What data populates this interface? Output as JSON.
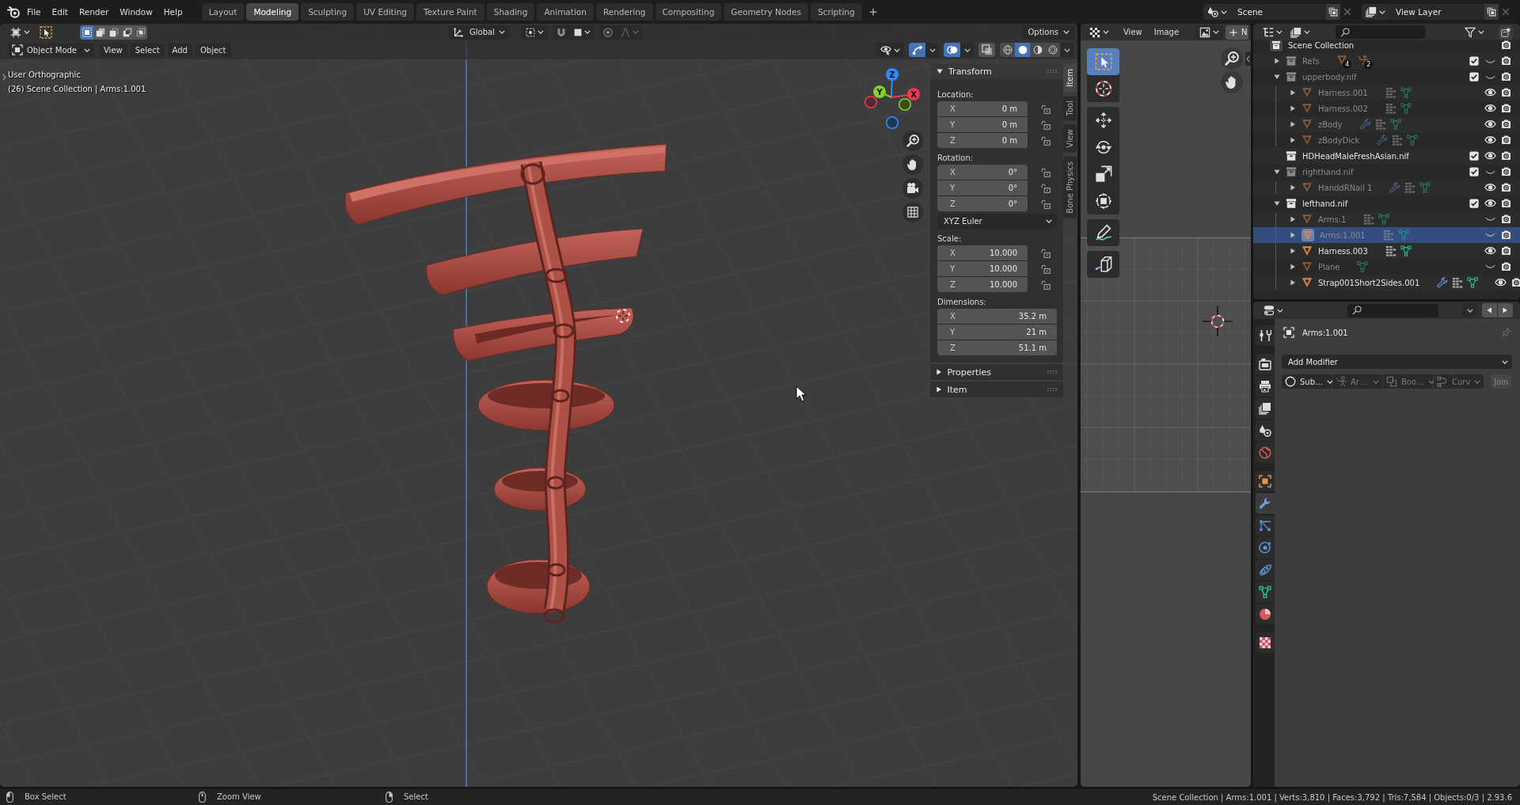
{
  "topbar": {
    "menus": [
      "File",
      "Edit",
      "Render",
      "Window",
      "Help"
    ],
    "workspaces": [
      {
        "label": "Layout",
        "selected": false
      },
      {
        "label": "Modeling",
        "selected": true
      },
      {
        "label": "Sculpting",
        "selected": false
      },
      {
        "label": "UV Editing",
        "selected": false
      },
      {
        "label": "Texture Paint",
        "selected": false
      },
      {
        "label": "Shading",
        "selected": false
      },
      {
        "label": "Animation",
        "selected": false
      },
      {
        "label": "Rendering",
        "selected": false
      },
      {
        "label": "Compositing",
        "selected": false
      },
      {
        "label": "Geometry Nodes",
        "selected": false
      },
      {
        "label": "Scripting",
        "selected": false
      }
    ],
    "scene": "Scene",
    "view_layer": "View Layer"
  },
  "viewport": {
    "tool_header": {
      "select_modes": [
        {
          "kind": "new",
          "selected": true
        },
        {
          "kind": "extend",
          "selected": false
        },
        {
          "kind": "subtract",
          "selected": false
        },
        {
          "kind": "invert",
          "selected": false
        },
        {
          "kind": "intersect",
          "selected": false
        }
      ],
      "orientation": "Global",
      "snap": {
        "on": false
      },
      "proportional_editing": {
        "on": false
      },
      "options": "Options"
    },
    "header": {
      "mode": "Object Mode",
      "menus": [
        "View",
        "Select",
        "Add",
        "Object"
      ],
      "toggles": [
        {
          "kind": "gizmos",
          "on": true
        },
        {
          "kind": "overlays",
          "on": true
        },
        {
          "kind": "xray",
          "on": false
        }
      ],
      "shading": [
        {
          "kind": "wireframe",
          "selected": false
        },
        {
          "kind": "solid",
          "selected": true
        },
        {
          "kind": "material",
          "selected": false
        },
        {
          "kind": "rendered",
          "selected": false
        }
      ]
    },
    "overlay_text": [
      "User Orthographic",
      "(26) Scene Collection | Arms:1.001"
    ],
    "gizmo": [
      {
        "kind": "z",
        "label": "Z"
      },
      {
        "kind": "y",
        "label": "Y"
      },
      {
        "kind": "x",
        "label": "X"
      }
    ],
    "sidebar": {
      "tabs": [
        {
          "label": "Item",
          "selected": true
        },
        {
          "label": "Tool",
          "selected": false
        },
        {
          "label": "View",
          "selected": false
        },
        {
          "label": "Bone Physics",
          "selected": false
        }
      ],
      "panels": [
        {
          "title": "Transform",
          "expanded": true,
          "groups": [
            {
              "label": "Location:",
              "fields": [
                {
                  "axis": "X",
                  "value": "0 m",
                  "locked": false
                },
                {
                  "axis": "Y",
                  "value": "0 m",
                  "locked": false
                },
                {
                  "axis": "Z",
                  "value": "0 m",
                  "locked": false
                }
              ]
            },
            {
              "label": "Rotation:",
              "fields": [
                {
                  "axis": "X",
                  "value": "0°",
                  "locked": false
                },
                {
                  "axis": "Y",
                  "value": "0°",
                  "locked": false
                },
                {
                  "axis": "Z",
                  "value": "0°",
                  "locked": false
                }
              ],
              "mode": "XYZ Euler"
            },
            {
              "label": "Scale:",
              "fields": [
                {
                  "axis": "X",
                  "value": "10.000",
                  "locked": false
                },
                {
                  "axis": "Y",
                  "value": "10.000",
                  "locked": false
                },
                {
                  "axis": "Z",
                  "value": "10.000",
                  "locked": false
                }
              ]
            },
            {
              "label": "Dimensions:",
              "fields": [
                {
                  "axis": "X",
                  "value": "35.2 m"
                },
                {
                  "axis": "Y",
                  "value": "21 m"
                },
                {
                  "axis": "Z",
                  "value": "51.1 m"
                }
              ]
            }
          ]
        },
        {
          "title": "Properties",
          "expanded": false
        },
        {
          "title": "Item",
          "expanded": false
        }
      ]
    }
  },
  "image_editor": {
    "menus": [
      "View",
      "Image"
    ],
    "new_button": "N",
    "tool_groups": [
      {
        "tools": [
          {
            "kind": "select-box",
            "selected": true
          },
          {
            "kind": "cursor",
            "selected": false
          }
        ]
      },
      {
        "tools": [
          {
            "kind": "move",
            "selected": false
          },
          {
            "kind": "rotate",
            "selected": false
          },
          {
            "kind": "scale",
            "selected": false
          },
          {
            "kind": "transform",
            "selected": false
          }
        ]
      },
      {
        "tools": [
          {
            "kind": "annotate",
            "selected": false
          }
        ]
      },
      {
        "tools": [
          {
            "kind": "sample",
            "selected": false
          }
        ]
      }
    ]
  },
  "outliner": {
    "tree": [
      {
        "kind": "scene",
        "name": "Scene Collection",
        "selected": false,
        "children": [
          {
            "kind": "collection",
            "name": "Refs",
            "expanded": false,
            "dimmed": true,
            "checked": true,
            "visible": false,
            "selected": false,
            "contents": [
              {
                "kind": "mesh",
                "count": "4"
              },
              {
                "kind": "armature",
                "count": "2"
              }
            ]
          },
          {
            "kind": "collection",
            "name": "upperbody.nif",
            "expanded": true,
            "dimmed": true,
            "checked": true,
            "visible": false,
            "selected": false,
            "children": [
              {
                "kind": "object",
                "name": "Harness.001",
                "expanded": false,
                "dimmed": true,
                "modifiers": false,
                "vertex_groups": true,
                "visible": true,
                "selected": false
              },
              {
                "kind": "object",
                "name": "Harness.002",
                "expanded": false,
                "dimmed": true,
                "modifiers": false,
                "vertex_groups": true,
                "visible": true,
                "selected": false
              },
              {
                "kind": "object",
                "name": "zBody",
                "expanded": false,
                "dimmed": true,
                "modifiers": true,
                "vertex_groups": true,
                "visible": true,
                "selected": false
              },
              {
                "kind": "object",
                "name": "zBodyDick",
                "expanded": false,
                "dimmed": true,
                "modifiers": true,
                "vertex_groups": true,
                "visible": true,
                "selected": false
              }
            ]
          },
          {
            "kind": "collection",
            "name": "HDHeadMaleFreshAsian.nif",
            "dimmed": false,
            "checked": true,
            "visible": true,
            "selected": false
          },
          {
            "kind": "collection",
            "name": "righthand.nif",
            "expanded": true,
            "dimmed": true,
            "checked": true,
            "visible": false,
            "selected": false,
            "children": [
              {
                "kind": "object",
                "name": "HanddRNail 1",
                "expanded": false,
                "dimmed": true,
                "modifiers": true,
                "vertex_groups": true,
                "visible": true,
                "selected": false
              }
            ]
          },
          {
            "kind": "collection",
            "name": "lefthand.nif",
            "expanded": true,
            "dimmed": false,
            "checked": true,
            "visible": true,
            "selected": false,
            "children": [
              {
                "kind": "object",
                "name": "Arms:1",
                "expanded": false,
                "dimmed": true,
                "modifiers": false,
                "vertex_groups": true,
                "visible": false,
                "selected": false
              },
              {
                "kind": "object",
                "name": "Arms:1.001",
                "expanded": false,
                "dimmed": true,
                "modifiers": false,
                "vertex_groups": true,
                "visible": false,
                "selected": true
              },
              {
                "kind": "object",
                "name": "Harness.003",
                "expanded": false,
                "dimmed": false,
                "modifiers": false,
                "vertex_groups": true,
                "visible": true,
                "selected": false
              },
              {
                "kind": "object",
                "name": "Plane",
                "expanded": false,
                "dimmed": true,
                "modifiers": false,
                "vertex_groups": false,
                "visible": false,
                "selected": false
              },
              {
                "kind": "object",
                "name": "Strap001Short2Sides.001",
                "expanded": false,
                "dimmed": false,
                "modifiers": true,
                "vertex_groups": true,
                "visible": true,
                "selected": false
              }
            ]
          }
        ]
      }
    ]
  },
  "properties": {
    "tab_groups": [
      {
        "tabs": [
          {
            "kind": "tool",
            "selected": false
          }
        ]
      },
      {
        "tabs": [
          {
            "kind": "render",
            "selected": false
          },
          {
            "kind": "output",
            "selected": false
          },
          {
            "kind": "view_layer",
            "selected": false
          },
          {
            "kind": "scene",
            "selected": false
          },
          {
            "kind": "world",
            "selected": false
          }
        ]
      },
      {
        "tabs": [
          {
            "kind": "object",
            "selected": false
          },
          {
            "kind": "modifiers",
            "selected": true
          },
          {
            "kind": "particles",
            "selected": false
          },
          {
            "kind": "physics",
            "selected": false
          },
          {
            "kind": "constraints",
            "selected": false
          },
          {
            "kind": "data",
            "selected": false
          },
          {
            "kind": "material",
            "selected": false
          }
        ]
      },
      {
        "tabs": [
          {
            "kind": "texture",
            "selected": false
          }
        ]
      }
    ],
    "object_name": "Arms:1.001",
    "add_modifier": "Add Modifier",
    "quick_modifiers": [
      {
        "kind": "subdivision",
        "label": "Sub…",
        "disabled": false
      },
      {
        "kind": "armature",
        "label": "Ar…",
        "disabled": true
      },
      {
        "kind": "boolean",
        "label": "Boo…",
        "disabled": true
      },
      {
        "kind": "curve",
        "label": "Curv",
        "disabled": true
      }
    ],
    "join": {
      "label": "Join",
      "disabled": true
    }
  },
  "status_bar": {
    "hints": [
      {
        "kind": "left",
        "label": "Box Select"
      },
      {
        "kind": "middle",
        "label": "Zoom View"
      },
      {
        "kind": "right",
        "label": "Select"
      }
    ],
    "stats": "Scene Collection | Arms:1.001 | Verts:3,810 | Faces:3,792 | Tris:7,584 | Objects:0/3 | 2.93.6"
  }
}
